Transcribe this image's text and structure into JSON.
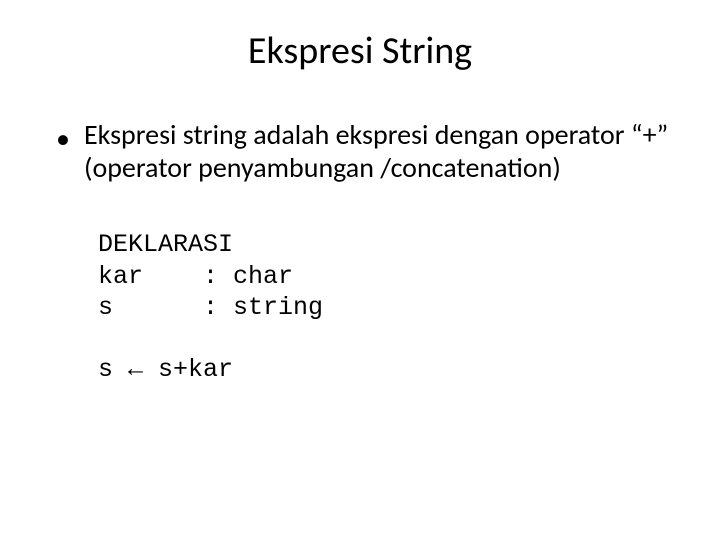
{
  "slide": {
    "title": "Ekspresi String",
    "bullet_text": "Ekspresi string adalah ekspresi dengan operator “+” (operator penyambungan /concatenation)",
    "decl_header": "DEKLARASI",
    "decl_line1": "kar    : char",
    "decl_line2": "s      : string",
    "code_line": "s ← s+kar"
  }
}
